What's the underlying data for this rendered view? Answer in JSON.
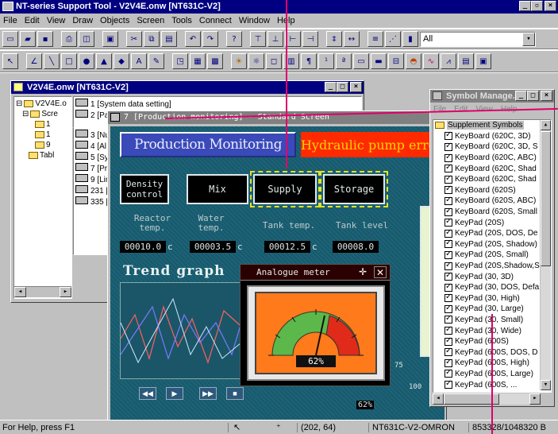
{
  "app": {
    "title": "NT-series Support Tool - V2V4E.onw [NT631C-V2]",
    "menu": [
      "File",
      "Edit",
      "View",
      "Draw",
      "Objects",
      "Screen",
      "Tools",
      "Connect",
      "Window",
      "Help"
    ],
    "layer_select": "All"
  },
  "project_window": {
    "title": "V2V4E.onw [NT631C-V2]",
    "tree": [
      "V2V4E.o",
      "Scre",
      "1",
      "1",
      "9",
      "Tabl"
    ],
    "screens": [
      "1 [System data setting]",
      "2 [Pa",
      "3 [Nu",
      "4 [Al",
      "5 [Sy",
      "7 [Pr",
      "9 [Lin",
      "231 [",
      "335 ["
    ]
  },
  "screen_window": {
    "title": "7 [Production monitoring] - Standard Screen",
    "header_title": "Production Monitoring",
    "alarm_text": "Hydraulic pump error",
    "buttons": [
      "Density\ncontrol",
      "Mix",
      "Supply",
      "Storage"
    ],
    "labels": [
      "Reactor\ntemp.",
      "Water\ntemp.",
      "Tank temp.",
      "Tank level"
    ],
    "values": [
      "00010.0",
      "00003.5",
      "00012.5",
      "00008.0"
    ],
    "unit": "c",
    "trend_label": "Trend graph",
    "meter_scale_1": "75",
    "meter_scale_2": "100",
    "percent_bottom": "62%"
  },
  "analogue_meter": {
    "title": "Analogue meter",
    "reading": "62%"
  },
  "symbol_manager": {
    "title": "Symbol Manage...",
    "menu": [
      "File",
      "Edit",
      "View",
      "Help"
    ],
    "group": "Supplement Symbols",
    "items": [
      "KeyBoard (620C, 3D)",
      "KeyBoard (620C, 3D, S",
      "KeyBoard (620C, ABC)",
      "KeyBoard (620C, Shad",
      "KeyBoard (620C, Shad",
      "KeyBoard (620S)",
      "KeyBoard (620S, ABC)",
      "KeyBoard (620S, Small",
      "KeyPad (20S)",
      "KeyPad (20S, DOS, De",
      "KeyPad (20S, Shadow)",
      "KeyPad (20S, Small)",
      "KeyPad (20S,Shadow,S",
      "KeyPad (30, 3D)",
      "KeyPad (30, DOS, Defa",
      "KeyPad (30, High)",
      "KeyPad (30, Large)",
      "KeyPad (30, Small)",
      "KeyPad (30, Wide)",
      "KeyPad (600S)",
      "KeyPad (600S, DOS, D",
      "KeyPad (600S, High)",
      "KeyPad (600S, Large)",
      "KeyPad (600S, ..."
    ]
  },
  "status": {
    "help": "For Help, press F1",
    "coords": "(202, 64)",
    "model": "NT631C-V2-OMRON",
    "memory": "853328/1048320 B"
  },
  "colors": {
    "title_active": "#000080",
    "screen_bg": "#1a5c70",
    "alarm_red": "#ff2a00",
    "alarm_text": "#ffd400",
    "header_blue": "#3a4ab8",
    "meter_orange": "#ff7a1a",
    "meter_green": "#5cb84a",
    "meter_red": "#e02a1a",
    "pointer": "#e0006a"
  }
}
